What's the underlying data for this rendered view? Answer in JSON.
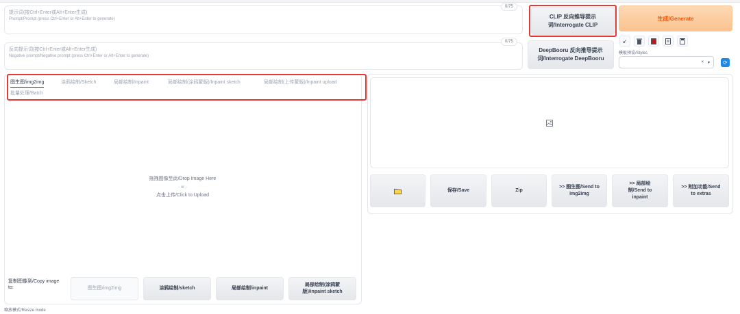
{
  "prompt": {
    "placeholder_cn": "提示词(按Ctrl+Enter或Alt+Enter生成)",
    "placeholder_en": "Prompt/Prompt (press Ctrl+Enter or Alt+Enter to generate)",
    "counter": "0/75"
  },
  "negative_prompt": {
    "placeholder_cn": "反向提示词(按Ctrl+Enter或Alt+Enter生成)",
    "placeholder_en": "Negative prompt/Negative prompt (press Ctrl+Enter or Alt+Enter to generate)",
    "counter": "0/75"
  },
  "interrogate_clip": {
    "line1": "CLIP 反向推导提示",
    "line2": "词/Interrogate CLIP"
  },
  "interrogate_deepbooru": {
    "line1": "DeepBooru 反向推导提示",
    "line2": "词/Interrogate DeepBooru"
  },
  "generate_label": "生成/Generate",
  "tools": {
    "icons": [
      "arrow-diagonal-icon",
      "trash-icon",
      "style-red-icon",
      "clipboard-icon",
      "save-icon"
    ],
    "glyphs": [
      "↙",
      "🗑",
      "■",
      "▤",
      "▣"
    ]
  },
  "styles": {
    "label": "模板预设/Styles",
    "clear": "×",
    "arrow": "▾",
    "refresh": "⟳"
  },
  "tabs": {
    "items": [
      "图生图/img2img",
      "涂鸦绘制/Sketch",
      "局部绘制/Inpaint",
      "局部绘制(涂鸦蒙版)/Inpaint sketch",
      "局部绘制(上传蒙版)/Inpaint upload",
      "批量处理/Batch"
    ],
    "active_index": 0
  },
  "dropzone": {
    "line1": "拖拽图像至此/Drop Image Here",
    "or": "- or -",
    "line2": "点击上传/Click to Upload"
  },
  "copy_image": {
    "label": "复制图像到/Copy image to:",
    "buttons": [
      "图生图/img2img",
      "涂鸦绘制/sketch",
      "局部绘制/inpaint",
      "局部绘制(涂鸦蒙版)/inpaint sketch"
    ]
  },
  "output": {
    "image_icon": "🖼",
    "buttons": {
      "folder": "📁",
      "save": "保存/Save",
      "zip": "Zip",
      "send_img2img": ">> 图生图/Send to img2img",
      "send_inpaint": ">> 局部绘制/Send to inpaint",
      "send_extras": ">> 附加功能/Send to extras"
    }
  },
  "resize_mode": "缩放模式/Resize mode",
  "colors": {
    "highlight": "#e53935",
    "generate_text": "#ea580c",
    "accent_blue": "#1e88e5"
  }
}
